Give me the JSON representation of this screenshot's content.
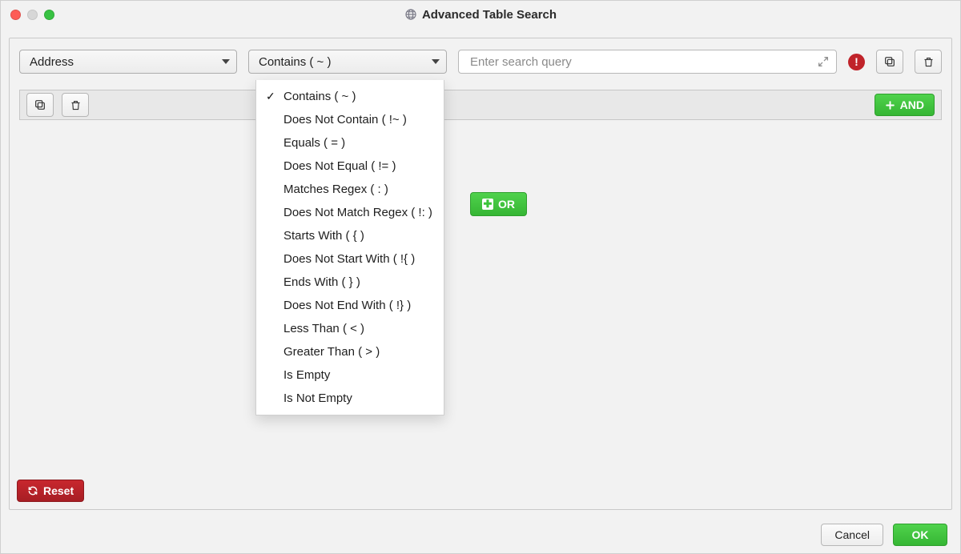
{
  "window": {
    "title": "Advanced Table Search"
  },
  "query": {
    "field_selected": "Address",
    "operator_selected": "Contains ( ~ )",
    "search_placeholder": "Enter search query",
    "search_value": ""
  },
  "operators": [
    "Contains ( ~ )",
    "Does Not Contain ( !~ )",
    "Equals ( = )",
    "Does Not Equal ( != )",
    "Matches Regex ( : )",
    "Does Not Match Regex ( !: )",
    "Starts With ( { )",
    "Does Not Start With ( !{ )",
    "Ends With ( } )",
    "Does Not End With ( !} )",
    "Less Than ( < )",
    "Greater Than ( > )",
    "Is Empty",
    "Is Not Empty"
  ],
  "operator_selected_index": 0,
  "buttons": {
    "and": "AND",
    "or": "OR",
    "reset": "Reset",
    "cancel": "Cancel",
    "ok": "OK"
  },
  "alert_char": "!"
}
